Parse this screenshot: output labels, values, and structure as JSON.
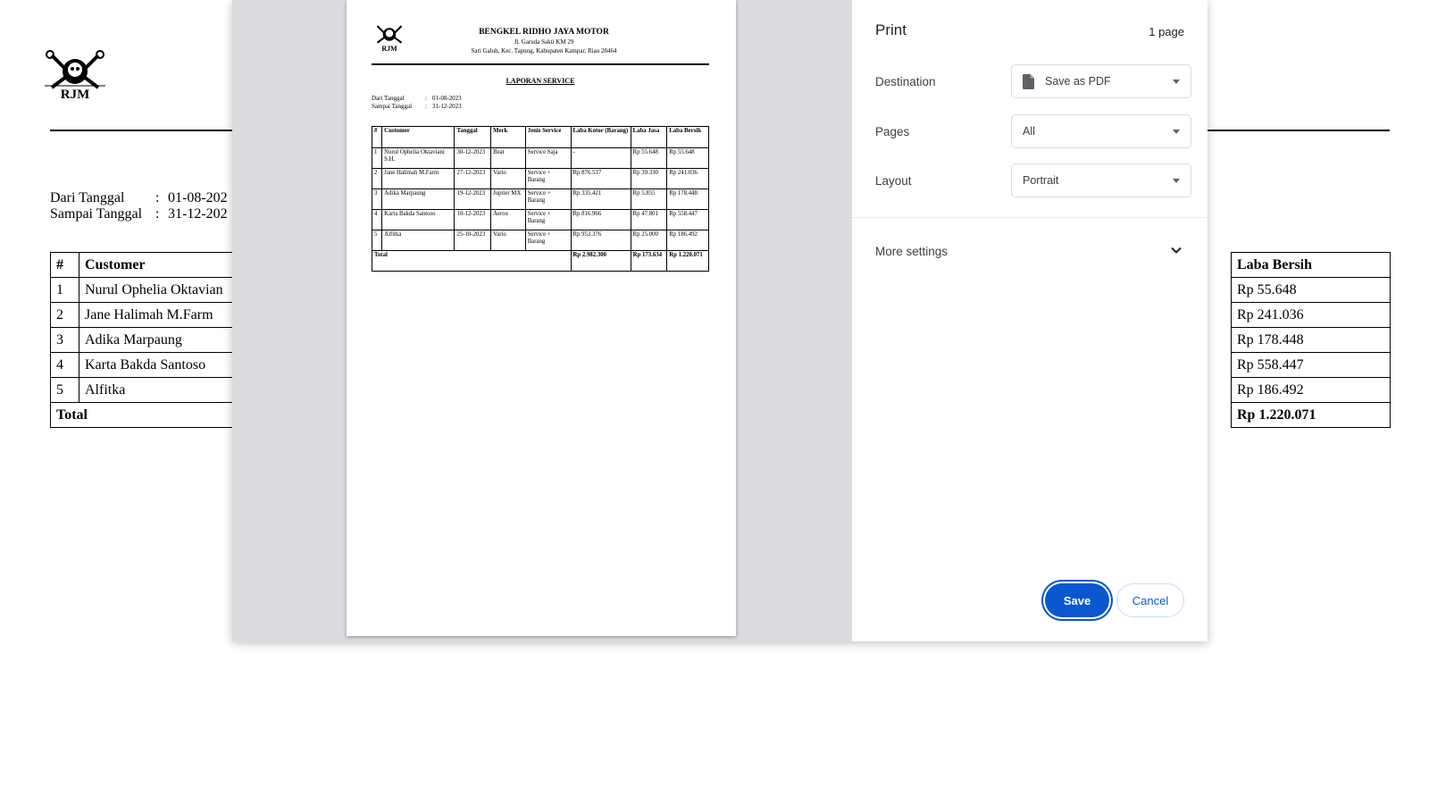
{
  "background": {
    "logo_text": "RJM",
    "dates": [
      {
        "label": "Dari Tanggal",
        "value": "01-08-202"
      },
      {
        "label": "Sampai Tanggal",
        "value": "31-12-202"
      }
    ],
    "left_headers": [
      "#",
      "Customer"
    ],
    "left_rows": [
      [
        "1",
        "Nurul Ophelia Oktavian"
      ],
      [
        "2",
        "Jane Halimah M.Farm"
      ],
      [
        "3",
        "Adika Marpaung"
      ],
      [
        "4",
        "Karta Bakda Santoso"
      ],
      [
        "5",
        "Alfitka"
      ]
    ],
    "left_total": "Total",
    "right_header": "Laba Bersih",
    "right_rows": [
      "Rp 55.648",
      "Rp 241.036",
      "Rp 178.448",
      "Rp 558.447",
      "Rp 186.492"
    ],
    "right_total": "Rp 1.220.071"
  },
  "preview": {
    "logo_text": "RJM",
    "company": "BENGKEL RIDHO JAYA MOTOR",
    "address_line1": "Jl. Garuda Sakti KM 29",
    "address_line2": "Sari Galuh, Kec. Tapung, Kabupaten Kampar, Riau 28464",
    "report_title": "LAPORAN SERVICE",
    "dates": [
      {
        "label": "Dari Tanggal",
        "value": "01-08-2023"
      },
      {
        "label": "Sampai Tanggal",
        "value": "31-12-2023"
      }
    ],
    "headers": [
      "#",
      "Customer",
      "Tanggal",
      "Merk",
      "Jenis Service",
      "Laba Kotor (Barang)",
      "Laba Jasa",
      "Laba Bersih"
    ],
    "rows": [
      [
        "1",
        "Nurul Ophelia Oktaviani S.H.",
        "30-12-2023",
        "Beat",
        "Service Saja",
        "-",
        "Rp 55.648",
        "Rp 55.648"
      ],
      [
        "2",
        "Jane Halimah M.Farm",
        "27-12-2023",
        "Vario",
        "Service + Barang",
        "Rp 876.537",
        "Rp 39.330",
        "Rp 241.036"
      ],
      [
        "3",
        "Adika Marpaung",
        "19-12-2023",
        "Jupiter MX",
        "Service + Barang",
        "Rp 335.421",
        "Rp 5.855",
        "Rp 178.448"
      ],
      [
        "4",
        "Karta Bakda Santoso",
        "10-12-2023",
        "Aerox",
        "Service + Barang",
        "Rp 816.966",
        "Rp 47.801",
        "Rp 558.447"
      ],
      [
        "5",
        "Alfitka",
        "25-10-2023",
        "Vario",
        "Service + Barang",
        "Rp 953.376",
        "Rp 25.000",
        "Rp 186.492"
      ]
    ],
    "total_label": "Total",
    "total_laba_kotor": "Rp 2.982.300",
    "total_laba_jasa": "Rp 173.634",
    "total_laba_bersih": "Rp 1.220.071"
  },
  "print_panel": {
    "title": "Print",
    "page_count": "1 page",
    "destination_label": "Destination",
    "destination_value": "Save as PDF",
    "destination_icon": "document-icon",
    "pages_label": "Pages",
    "pages_value": "All",
    "layout_label": "Layout",
    "layout_value": "Portrait",
    "more_settings": "More settings",
    "save": "Save",
    "cancel": "Cancel",
    "accent_color": "#0b57d0"
  }
}
